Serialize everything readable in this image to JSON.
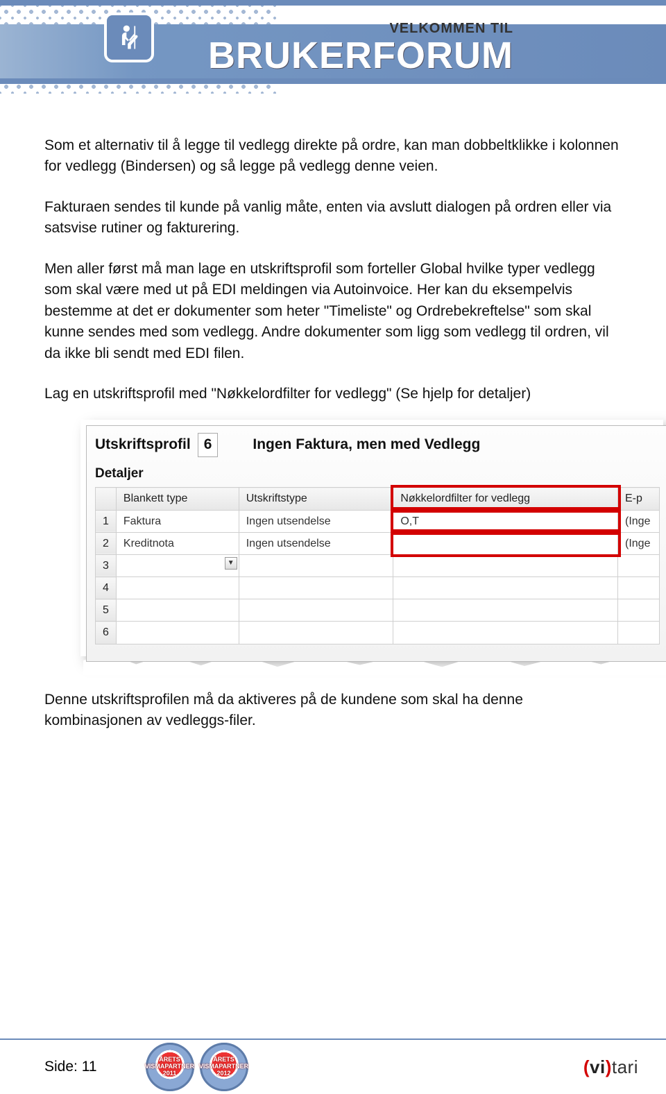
{
  "banner": {
    "welcome": "VELKOMMEN TIL",
    "title": "BRUKERFORUM"
  },
  "paragraphs": {
    "p1": "Som et alternativ til å legge til vedlegg direkte på ordre, kan man dobbeltklikke i kolonnen for vedlegg (Bindersen) og så legge på vedlegg denne veien.",
    "p2": "Fakturaen sendes til kunde på vanlig måte, enten via avslutt dialogen på ordren eller via satsvise rutiner og fakturering.",
    "p3": "Men aller først må man lage en utskriftsprofil som forteller Global hvilke typer vedlegg som skal være med ut på EDI meldingen via Autoinvoice. Her kan du eksempelvis bestemme at det er dokumenter som heter \"Timeliste\" og Ordrebekreftelse\" som skal kunne sendes med som vedlegg. Andre dokumenter som ligg som vedlegg til ordren, vil da ikke bli sendt med EDI filen.",
    "p4": "Lag en utskriftsprofil med \"Nøkkelordfilter for vedlegg\" (Se hjelp for detaljer)",
    "p5": "Denne utskriftsprofilen må da aktiveres på de kundene som skal ha denne kombinasjonen av vedleggs-filer."
  },
  "screenshot": {
    "profile_label": "Utskriftsprofil",
    "profile_number": "6",
    "profile_title": "Ingen Faktura, men med Vedlegg",
    "details_label": "Detaljer",
    "columns": [
      "Blankett type",
      "Utskriftstype",
      "Nøkkelordfilter for vedlegg",
      "E-p"
    ],
    "rows": [
      {
        "n": "1",
        "c": [
          "Faktura",
          "Ingen utsendelse",
          "O,T",
          "(Inge"
        ]
      },
      {
        "n": "2",
        "c": [
          "Kreditnota",
          "Ingen utsendelse",
          "",
          "(Inge"
        ]
      },
      {
        "n": "3",
        "c": [
          "",
          "",
          "",
          ""
        ]
      },
      {
        "n": "4",
        "c": [
          "",
          "",
          "",
          ""
        ]
      },
      {
        "n": "5",
        "c": [
          "",
          "",
          "",
          ""
        ]
      },
      {
        "n": "6",
        "c": [
          "",
          "",
          "",
          ""
        ]
      }
    ]
  },
  "footer": {
    "page_label": "Side: 11",
    "badges": [
      "ÅRETS VISMAPARTNER 2011",
      "ÅRETS VISMAPARTNER 2012"
    ],
    "logo_parts": [
      "vi",
      "tari"
    ]
  }
}
